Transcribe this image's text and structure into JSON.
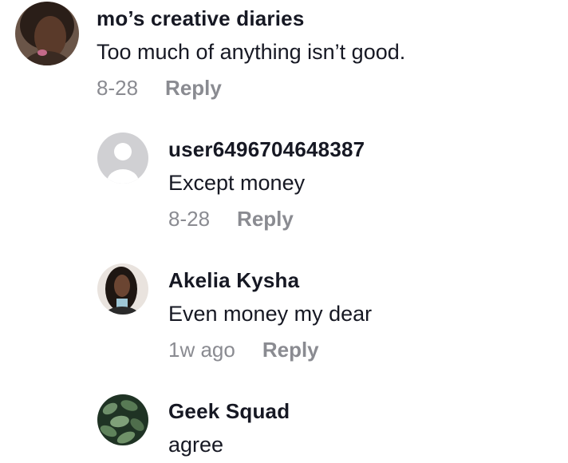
{
  "comments": [
    {
      "username": "mo’s creative diaries",
      "text": "Too much of anything isn’t good.",
      "timestamp": "8-28",
      "reply_label": "Reply",
      "avatar": "profile-photo"
    },
    {
      "username": "user6496704648387",
      "text": "Except money",
      "timestamp": "8-28",
      "reply_label": "Reply",
      "avatar": "default-user-icon"
    },
    {
      "username": "Akelia Kysha",
      "text": "Even money my dear",
      "timestamp": "1w ago",
      "reply_label": "Reply",
      "avatar": "profile-photo"
    },
    {
      "username": "Geek Squad",
      "text": "agree",
      "avatar": "plant-leaves-photo"
    }
  ],
  "colors": {
    "username": "#161823",
    "text": "#161823",
    "meta": "#8a8b91",
    "default_avatar_bg": "#d0d0d3"
  }
}
